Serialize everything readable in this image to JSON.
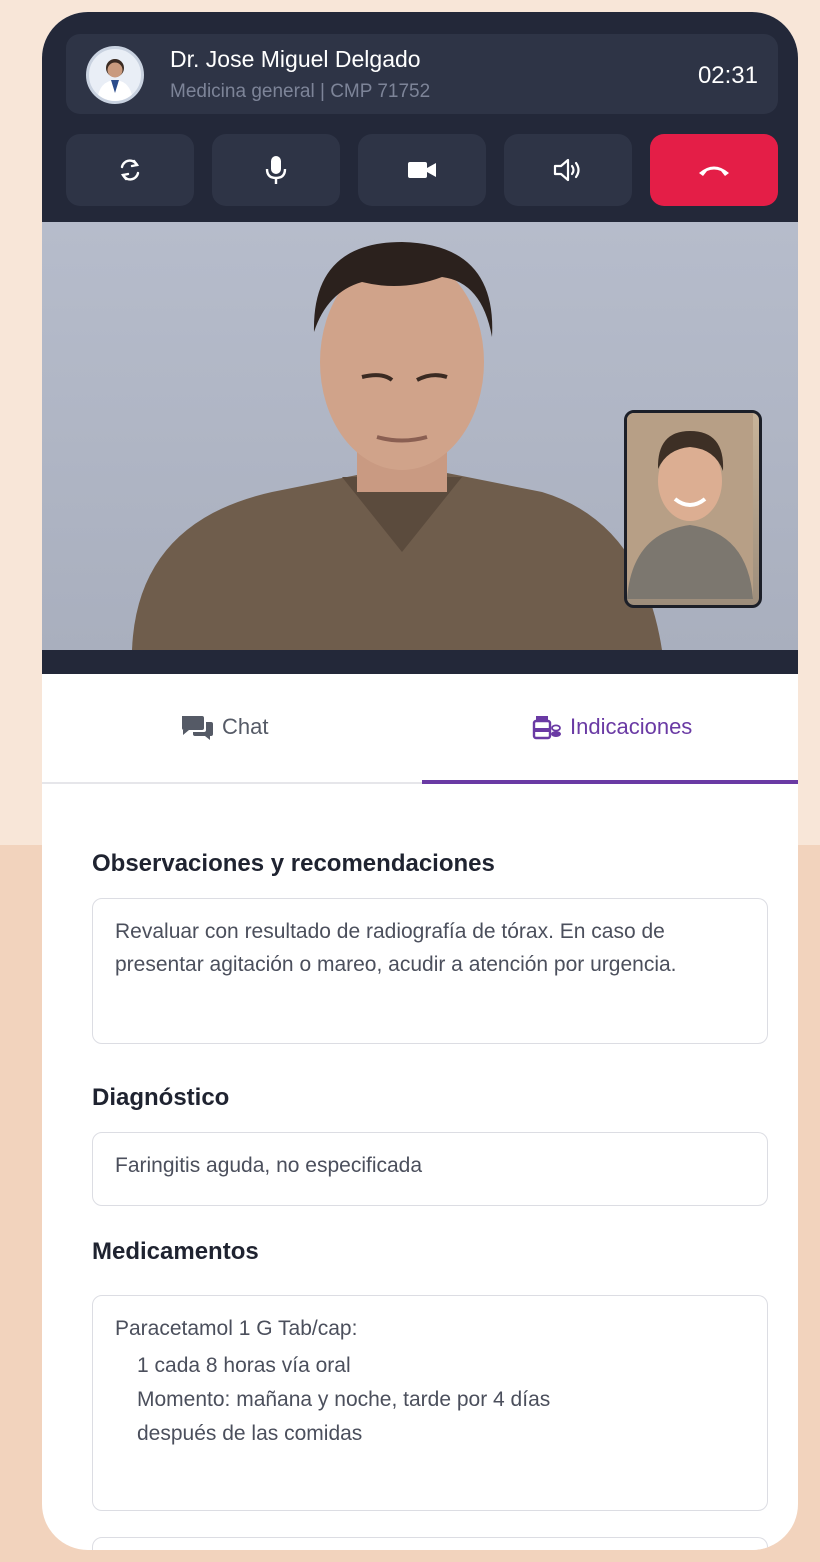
{
  "call": {
    "doctor_name": "Dr. Jose Miguel Delgado",
    "doctor_subtitle": "Medicina general | CMP 71752",
    "timer": "02:31"
  },
  "controls": [
    {
      "name": "switch-camera",
      "icon": "switch-camera-icon"
    },
    {
      "name": "microphone",
      "icon": "microphone-icon"
    },
    {
      "name": "camera",
      "icon": "video-camera-icon"
    },
    {
      "name": "speaker",
      "icon": "speaker-icon"
    },
    {
      "name": "end-call",
      "icon": "phone-hangup-icon",
      "color": "#e41e47"
    }
  ],
  "tabs": {
    "chat": "Chat",
    "indicaciones": "Indicaciones",
    "active": "indicaciones",
    "accent": "#6a3aa4"
  },
  "observaciones": {
    "title": "Observaciones y recomendaciones",
    "text": "Revaluar con resultado de radiografía de tórax. En caso de presentar agitación o mareo, acudir a atención por urgencia."
  },
  "diagnostico": {
    "title": "Diagnóstico",
    "text": "Faringitis aguda, no especificada"
  },
  "medicamentos": {
    "title": "Medicamentos",
    "items": [
      {
        "name": "Paracetamol 1 G Tab/cap:",
        "dose": "1  cada 8 horas vía oral",
        "timing": "Momento: mañana y  noche, tarde por 4 días",
        "note": "después de las comidas"
      }
    ]
  }
}
